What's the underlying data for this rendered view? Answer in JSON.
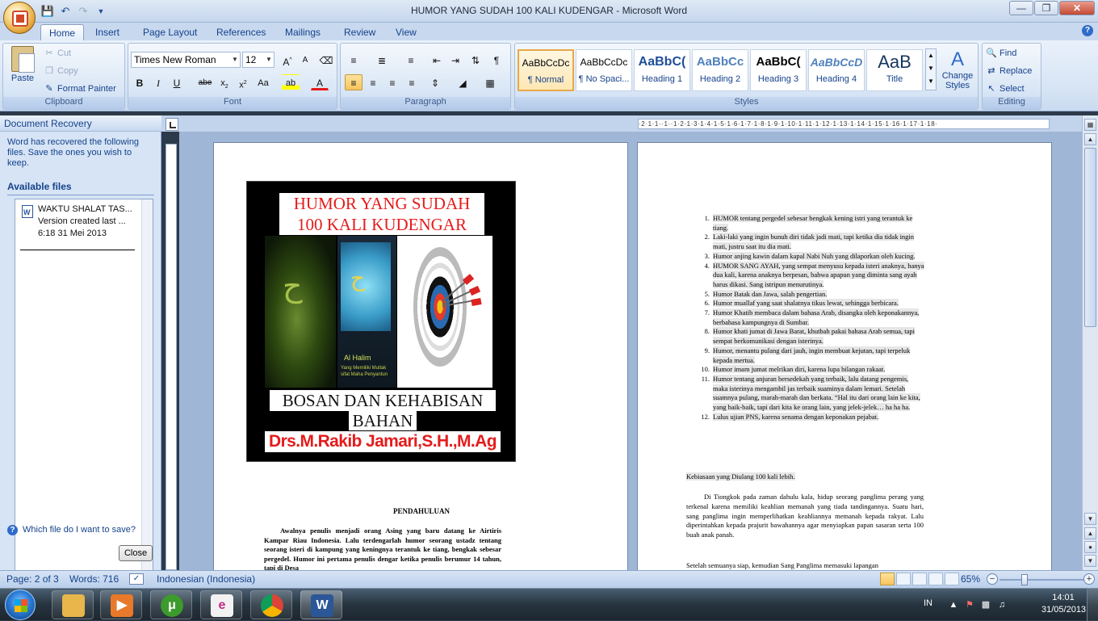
{
  "window": {
    "title": "HUMOR YANG SUDAH 100 KALI KUDENGAR - Microsoft Word"
  },
  "ribbon_tabs": [
    "Home",
    "Insert",
    "Page Layout",
    "References",
    "Mailings",
    "Review",
    "View"
  ],
  "clipboard": {
    "paste": "Paste",
    "cut": "Cut",
    "copy": "Copy",
    "format_painter": "Format Painter",
    "label": "Clipboard"
  },
  "font": {
    "name": "Times New Roman",
    "size": "12",
    "label": "Font"
  },
  "paragraph": {
    "label": "Paragraph"
  },
  "styles": {
    "label": "Styles",
    "items": [
      {
        "sample": "AaBbCcDc",
        "name": "¶ Normal"
      },
      {
        "sample": "AaBbCcDc",
        "name": "¶ No Spaci..."
      },
      {
        "sample": "AaBbC(",
        "name": "Heading 1"
      },
      {
        "sample": "AaBbCc",
        "name": "Heading 2"
      },
      {
        "sample": "AaBbC(",
        "name": "Heading 3"
      },
      {
        "sample": "AaBbCcD",
        "name": "Heading 4"
      },
      {
        "sample": "AaB",
        "name": "Title"
      }
    ],
    "change_styles": "Change Styles"
  },
  "editing": {
    "label": "Editing",
    "find": "Find",
    "replace": "Replace",
    "select": "Select"
  },
  "recovery": {
    "title": "Document Recovery",
    "message": "Word has recovered the following files.  Save the ones you wish to keep.",
    "available": "Available files",
    "file_name": "WAKTU SHALAT TAS...",
    "file_version": "Version created last ...",
    "file_time": "6:18 31 Mei 2013",
    "help_link": "Which file do I want to save?",
    "close": "Close"
  },
  "ruler_text": "·2·1·1··1··1·2·1·3·1·4·1·5·1·6·1·7·1·8·1·9·1·10·1·11·1·12·1·13·1·14·1·15·1·16·1·17·1·18·",
  "page1": {
    "cover_title_1": "HUMOR YANG SUDAH",
    "cover_title_2": "100 KALI KUDENGAR",
    "cover_caption_1": "Al Halim",
    "cover_caption_2": "Yang Memiliki Mutlak sifat Maha Penyantun",
    "cover_subtitle_1": "BOSAN DAN KEHABISAN",
    "cover_subtitle_2": "BAHAN",
    "cover_author": "Drs.M.Rakib Jamari,S.H.,M.Ag",
    "heading": "PENDAHULUAN",
    "body": "Awalnya penulis menjadi orang Asing yang baru datang ke Airtiris Kampar Riau Indonesia. Lalu terdengarlah humor seorang ustadz tentang seorang isteri di kampung yang keningnya terantuk ke tiang, bengkak sebesar pergedel. Humor ini pertama penulis dengar ketika penulis berumur 14 tahun, tapi di Desa"
  },
  "page2": {
    "list": [
      "HUMOR tentang  pergedel sebesar bengkak kening istri yang terantuk ke tiang.",
      "Laki-laki yang ingin bunuh diri tidak jadi mati, tapi ketika dia tidak ingin mati, justru saat itu dia mati.",
      "Humor anjing kawin dalam kapal Nabi Nuh yang dilaporkan oleh kucing.",
      "HUMOR SANG AYAH, yang sempat  menyusu kepada isteri anaknya, hanya dua kali, karena anaknya berpesan,  bahwa apapun yang diminta  sang ayah harus dikasi. Sang istripun menurutinya.",
      "Humor Batak dan Jawa, salah pengertian.",
      "Humor muallaf yang  saat shalatnya tikus lewat,  sehingga berbicara.",
      "Humor Khatib membaca dalam bahasa Arab, disangka oleh keponakannya,  berbahasa  kampungnya di Sumbar.",
      "Humor khati jumat di Jawa Barat, khutbah pakai bahasa Arab semua, tapi sempat berkomunikasi  dengan isterinya.",
      "Humor, menantu  pulang dari jauh, ingin membuat kejutan, tapi terpeluk kepada  mertua.",
      "Humor imam jumat melrikan diri, karena  lupa bilangan  rakaat.",
      "Humor tentang  anjuran bersedekah  yang terbaik, lalu datang pengemis, maka isterinya mengambil jas terbaik suaminya dalam lemari.  Setelah suamnya pulang, marah-marah  dan berkata. “Hal itu dari orang lain ke kita, yang baik-baik,  tapi dari kita ke orang lain, yang jelek-jelek… ha  ha   ha.",
      "Lulus ujian PNS, karena senama dengan  keponakan  pejabat."
    ],
    "para_a": "Kebiasaan  yang Diulang 100 kali lebih.",
    "para_b": "Di  Tiongkok  pada  zaman  dahulu  kala,  hidup  seorang  panglima perang  yang  terkenal  karena  memiliki  keahlian  memanah  yang  tiada tandingannya.   Suatu  hari,   sang  panglima  ingin  memperlihatkan keahliannya  memanah  kepada  rakyat.  Lalu  diperintahkan  kepada prajurit  bawahannya  agar  menyiapkan  papan  sasaran  serta  100  buah anak panah.",
    "para_c": "Setelah  semuanya  siap,  kemudian  Sang  Panglima  memasuki  lapangan"
  },
  "status": {
    "page": "Page: 2 of 3",
    "words": "Words: 716",
    "language": "Indonesian (Indonesia)",
    "zoom": "65%"
  },
  "taskbar": {
    "lang": "IN",
    "time": "14:01",
    "date": "31/05/2013"
  }
}
